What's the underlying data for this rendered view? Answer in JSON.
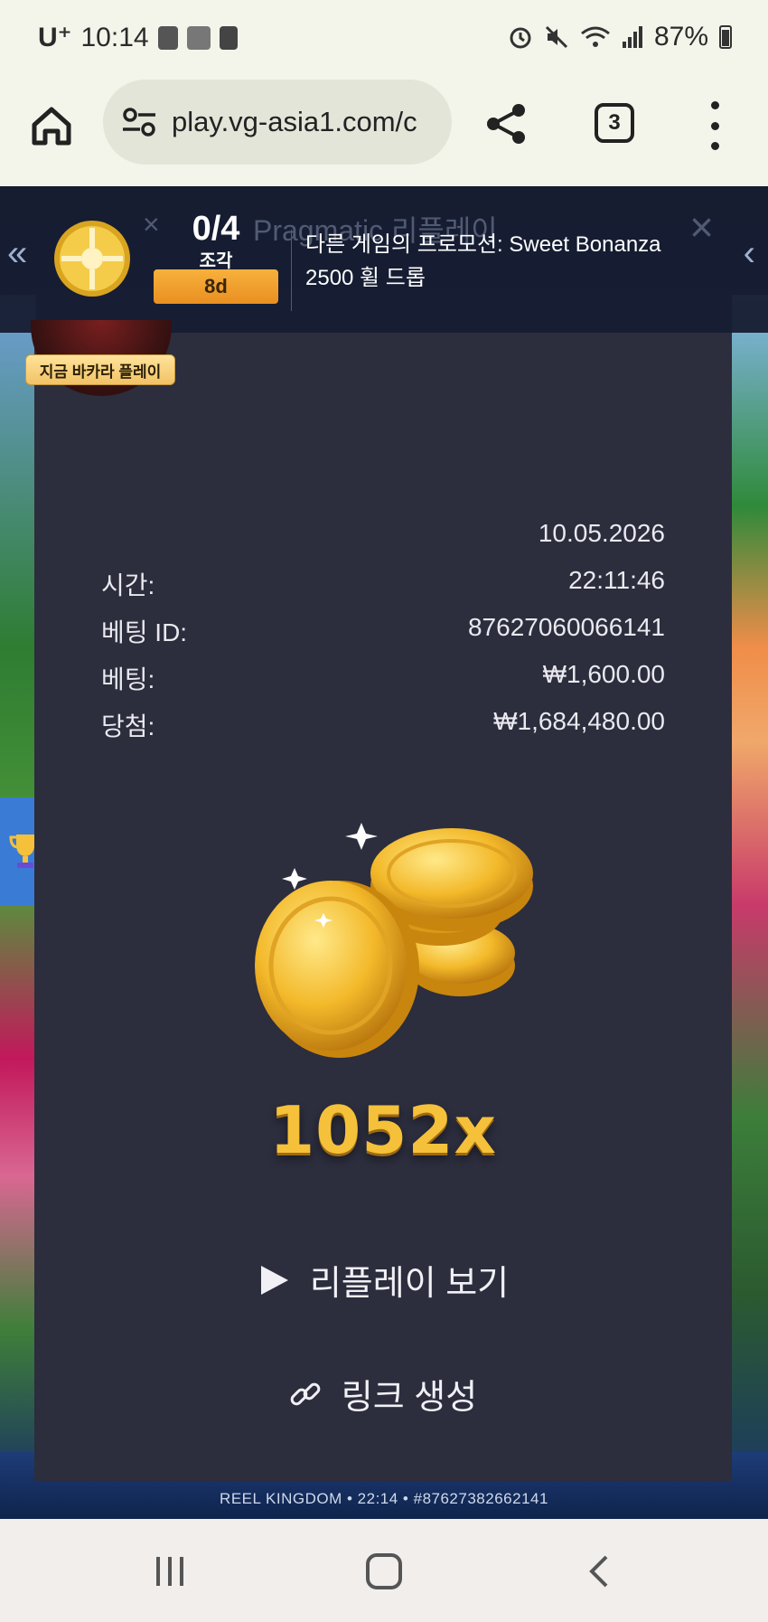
{
  "status_bar": {
    "carrier": "U⁺",
    "time": "10:14",
    "battery": "87%"
  },
  "browser": {
    "url": "play.vg-asia1.com/c",
    "tab_count": "3"
  },
  "promo": {
    "counter": "0/4",
    "piece_label": "조각",
    "days_left": "8d",
    "faint_title": "Pragmatic 리플레이",
    "text": "다른 게임의 프로모션: Sweet Bonanza 2500 휠 드롭",
    "play_label": "지금 바카라 플레이"
  },
  "bet_details": {
    "date": "10.05.2026",
    "time_label": "시간:",
    "time_value": "22:11:46",
    "bet_id_label": "베팅 ID:",
    "bet_id_value": "87627060066141",
    "bet_label": "베팅:",
    "bet_value": "₩1,600.00",
    "win_label": "당첨:",
    "win_value": "₩1,684,480.00"
  },
  "result": {
    "multiplier": "1052x"
  },
  "actions": {
    "replay_label": "리플레이 보기",
    "link_label": "링크 생성"
  },
  "footer": {
    "round_ref": "REEL KINGDOM • 22:14 • #87627382662141"
  },
  "colors": {
    "modal_bg": "#2c2d3d",
    "gold": "#f5c13a",
    "promo_badge": "#f0a02a"
  }
}
